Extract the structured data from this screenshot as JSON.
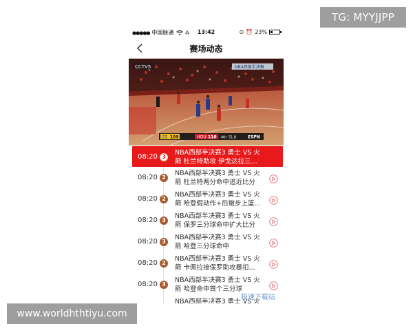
{
  "watermarks": {
    "tg": "TG: MYYJJPP",
    "url": "www.worldhthtiyu.com",
    "bottom": "极速下载站"
  },
  "status_bar": {
    "carrier": "中国联通",
    "time": "13:42",
    "battery": "23%"
  },
  "nav": {
    "title": "赛场动态",
    "back_icon": "chevron-left-icon"
  },
  "video": {
    "channel_logo": "CCTV5",
    "score": {
      "team_a": "GS",
      "score_a": "109",
      "team_b": "HOU",
      "score_b": "110",
      "quarter": "4th",
      "clock": "51.8",
      "broadcaster": "ESPN"
    },
    "banner": "NBA西部半决赛"
  },
  "events": [
    {
      "time": "08:20",
      "quarter": "3",
      "line1": "NBA西部半决赛3 勇士 VS 火",
      "line2": "箭 杜兰特助攻 伊戈达拉三...",
      "active": true
    },
    {
      "time": "08:20",
      "quarter": "2",
      "line1": "NBA西部半决赛3 勇士 VS 火",
      "line2": "箭 杜兰特两分命中追近比分",
      "active": false
    },
    {
      "time": "08:20",
      "quarter": "2",
      "line1": "NBA西部半决赛3 勇士 VS 火",
      "line2": "箭 哈登假动作+后撤步上篮...",
      "active": false
    },
    {
      "time": "08:20",
      "quarter": "3",
      "line1": "NBA西部半决赛3 勇士 VS 火",
      "line2": "箭 保罗三分球命中扩大比分",
      "active": false
    },
    {
      "time": "08:20",
      "quarter": "3",
      "line1": "NBA西部半决赛3 勇士 VS 火",
      "line2": "箭 哈登三分球命中",
      "active": false
    },
    {
      "time": "08:20",
      "quarter": "2",
      "line1": "NBA西部半决赛3 勇士 VS 火",
      "line2": "箭 卡佩拉接保罗助攻暴扣...",
      "active": false
    },
    {
      "time": "08:20",
      "quarter": "3",
      "line1": "NBA西部半决赛3 勇士 VS 火",
      "line2": "箭 哈登命中首个三分球",
      "active": false
    },
    {
      "time": "",
      "quarter": "",
      "line1": "NBA西部半决赛3 勇士 VS 火",
      "line2": "",
      "active": false
    }
  ],
  "colors": {
    "accent_red": "#e8191a",
    "badge_brown": "#a85a2c",
    "play_icon_red": "#e26b6b"
  }
}
